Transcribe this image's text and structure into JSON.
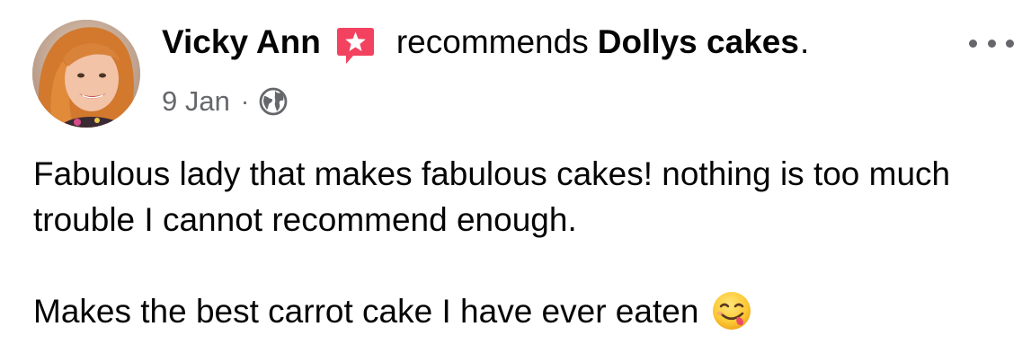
{
  "post": {
    "author": "Vicky Ann",
    "recommend_text": "recommends",
    "page_name": "Dollys cakes",
    "period": ".",
    "date": "9 Jan",
    "separator": "·",
    "body_paragraph_1": "Fabulous lady that makes fabulous cakes! nothing is too much trouble I cannot recommend enough.",
    "body_paragraph_2": "Makes the best carrot cake I have ever eaten"
  },
  "icons": {
    "recommend_badge": "recommend-star-icon",
    "more": "more-options-icon",
    "privacy": "globe-icon",
    "emoji": "face-savoring-food-emoji-icon"
  },
  "colors": {
    "text": "#050505",
    "secondary_text": "#65676b",
    "recommend_badge": "#f3425f"
  }
}
